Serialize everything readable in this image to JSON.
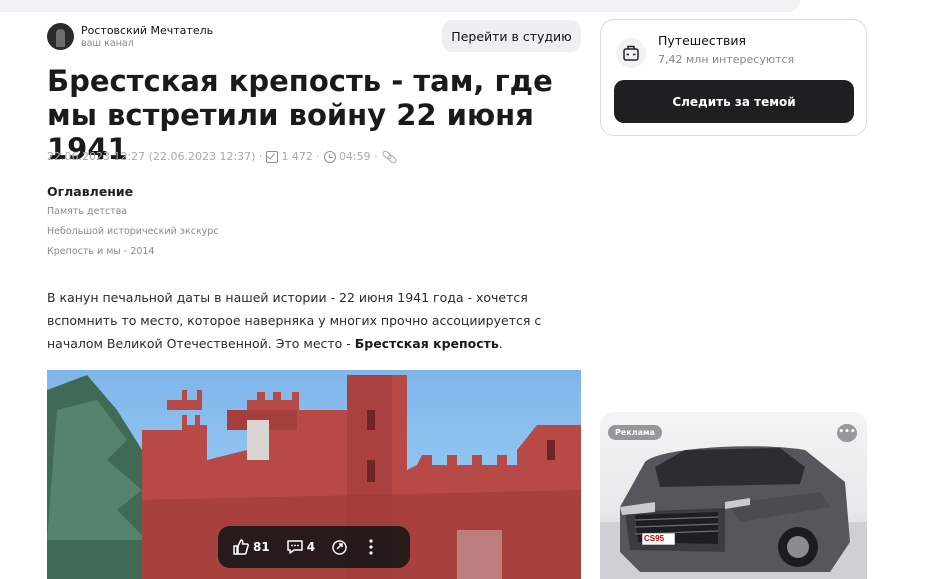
{
  "channel": {
    "name": "Ростовский Мечтатель",
    "subtitle": "ваш канал",
    "studio_button": "Перейти в студию"
  },
  "article": {
    "title": "Брестская крепость - там, где мы встретили войну 22 июня 1941",
    "meta": {
      "date": "22.06.2023 12:27 (22.06.2023 12:37)",
      "views": "1 472",
      "read_time": "04:59"
    },
    "toc": {
      "title": "Оглавление",
      "items": [
        "Память детства",
        "Небольшой исторический экскурс",
        "Крепость и мы - 2014"
      ]
    },
    "paragraph": {
      "text": "В канун печальной даты в нашей истории - 22 июня 1941 года - хочется вспомнить то место, которое наверняка у многих прочно ассоциируется с началом Великой Отечественной. Это место - ",
      "bold": "Брестская крепость",
      "end": "."
    },
    "reactions": {
      "likes": "81",
      "comments": "4"
    }
  },
  "topic": {
    "name": "Путешествия",
    "subscribers": "7,42 млн интересуются",
    "follow_button": "Следить за темой"
  },
  "ad": {
    "label": "Реклама",
    "more": "•••",
    "plate": "CS95"
  },
  "icons": [
    "channel-avatar",
    "views-icon",
    "clock-icon",
    "link-icon",
    "suitcase-icon",
    "like-icon",
    "comment-icon",
    "share-icon",
    "more-icon"
  ]
}
